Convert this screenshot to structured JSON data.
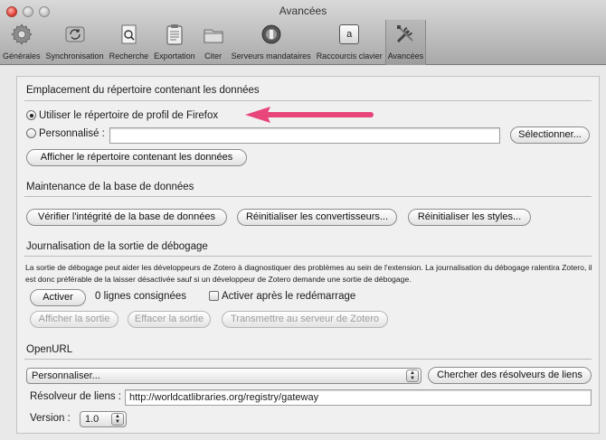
{
  "window": {
    "title": "Avancées"
  },
  "toolbar": {
    "tabs": [
      {
        "label": "Générales",
        "icon": "gear-icon"
      },
      {
        "label": "Synchronisation",
        "icon": "sync-icon"
      },
      {
        "label": "Recherche",
        "icon": "search-doc-icon"
      },
      {
        "label": "Exportation",
        "icon": "clipboard-icon"
      },
      {
        "label": "Citer",
        "icon": "folder-icon"
      },
      {
        "label": "Serveurs mandataires",
        "icon": "proxy-icon"
      },
      {
        "label": "Raccourcis clavier",
        "icon": "keyboard-key-icon",
        "key": "a"
      },
      {
        "label": "Avancées",
        "icon": "tools-icon"
      }
    ]
  },
  "data_dir": {
    "heading": "Emplacement du répertoire contenant les données",
    "option_profile": "Utiliser le répertoire de profil de Firefox",
    "option_custom": "Personnalisé :",
    "custom_path": "",
    "select_button": "Sélectionner...",
    "show_button": "Afficher le répertoire contenant les données"
  },
  "maintenance": {
    "heading": "Maintenance de la base de données",
    "check_button": "Vérifier l'intégrité de la base de données",
    "reset_translators": "Réinitialiser les convertisseurs...",
    "reset_styles": "Réinitialiser les styles..."
  },
  "debug": {
    "heading": "Journalisation de la sortie de débogage",
    "description": "La sortie de débogage peut aider les développeurs de Zotero à diagnostiquer des problèmes au sein de l'extension. La journalisation du débogage ralentira Zotero, il est donc préférable de la laisser désactivée sauf si un développeur de Zotero demande une sortie de débogage.",
    "enable_button": "Activer",
    "lines_logged": "0 lignes consignées",
    "after_restart": "Activer après le redémarrage",
    "view_button": "Afficher la sortie",
    "clear_button": "Effacer la sortie",
    "submit_button": "Transmettre au serveur de Zotero"
  },
  "openurl": {
    "heading": "OpenURL",
    "resolver_select": "Personnaliser...",
    "find_button": "Chercher des résolveurs de liens",
    "resolver_label": "Résolveur de liens :",
    "resolver_value": "http://worldcatlibraries.org/registry/gateway",
    "version_label": "Version :",
    "version_value": "1.0"
  },
  "colors": {
    "arrow": "#e8457a",
    "window_bg": "#e9e9e9",
    "panel_bg": "#f0f0f0"
  }
}
